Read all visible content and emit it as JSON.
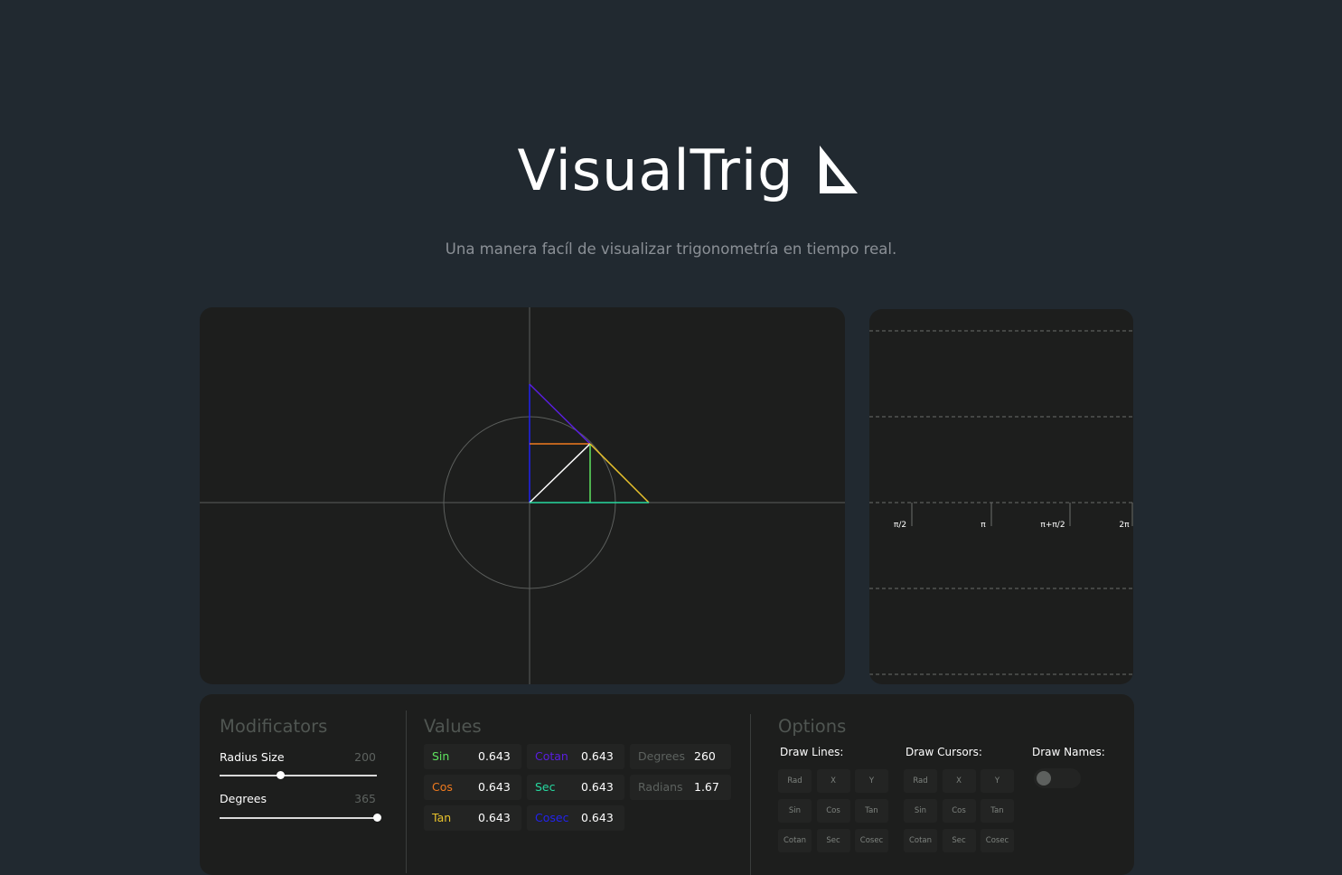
{
  "header": {
    "title": "VisualTrig",
    "logo_icon": "set-square-triangle",
    "subtitle": "Una manera facíl de visualizar trigonometría en tiempo real."
  },
  "graph": {
    "ticks": [
      "π/2",
      "π",
      "π+π/2",
      "2π"
    ]
  },
  "modificators": {
    "title": "Modificators",
    "radius": {
      "label": "Radius Size",
      "value": "200",
      "fraction": 0.39
    },
    "degrees": {
      "label": "Degrees",
      "value": "365",
      "fraction": 1.0
    }
  },
  "values": {
    "title": "Values",
    "sin": {
      "label": "Sin",
      "value": "0.643",
      "color": "#5ee35e"
    },
    "cos": {
      "label": "Cos",
      "value": "0.643",
      "color": "#f07a1e"
    },
    "tan": {
      "label": "Tan",
      "value": "0.643",
      "color": "#e8c22c"
    },
    "cotan": {
      "label": "Cotan",
      "value": "0.643",
      "color": "#5a1ee0"
    },
    "sec": {
      "label": "Sec",
      "value": "0.643",
      "color": "#26d9a0"
    },
    "cosec": {
      "label": "Cosec",
      "value": "0.643",
      "color": "#2222ee"
    },
    "degrees": {
      "label": "Degrees",
      "value": "260"
    },
    "radians": {
      "label": "Radians",
      "value": "1.67"
    }
  },
  "options": {
    "title": "Options",
    "draw_lines": {
      "label": "Draw Lines:",
      "buttons": [
        "Rad",
        "X",
        "Y",
        "Sin",
        "Cos",
        "Tan",
        "Cotan",
        "Sec",
        "Cosec"
      ]
    },
    "draw_cursors": {
      "label": "Draw Cursors:",
      "buttons": [
        "Rad",
        "X",
        "Y",
        "Sin",
        "Cos",
        "Tan",
        "Cotan",
        "Sec",
        "Cosec"
      ]
    },
    "draw_names": {
      "label": "Draw Names:",
      "enabled": false
    }
  }
}
